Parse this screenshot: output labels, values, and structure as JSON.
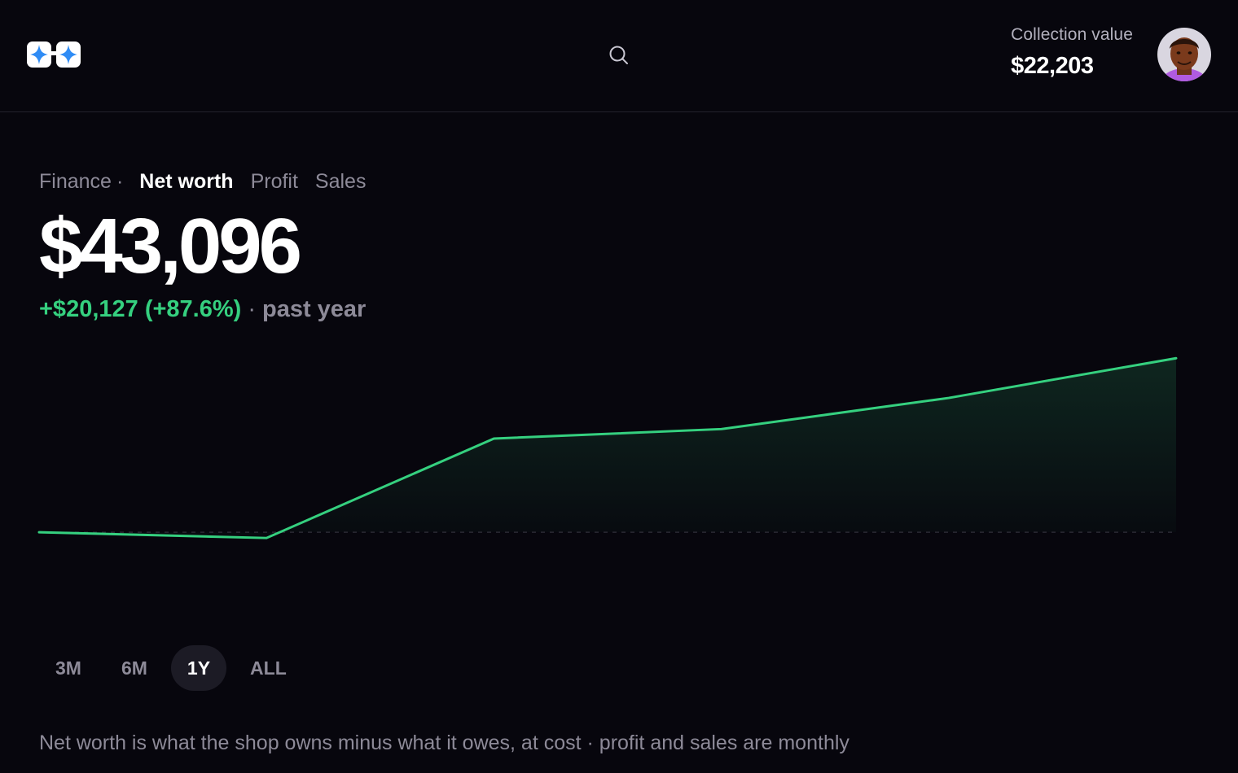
{
  "header": {
    "logo_icon": "sparkle-glasses-logo",
    "search_icon": "search-icon",
    "collection_label": "Collection value",
    "collection_value": "$22,203",
    "avatar_icon": "user-avatar"
  },
  "nav": {
    "section": "Finance",
    "separator": "·",
    "tabs": [
      {
        "label": "Net worth",
        "active": true
      },
      {
        "label": "Profit",
        "active": false
      },
      {
        "label": "Sales",
        "active": false
      }
    ]
  },
  "summary": {
    "value": "$43,096",
    "change": "+$20,127 (+87.6%)",
    "separator": "·",
    "period": "past year"
  },
  "colors": {
    "accent_green": "#35d07f",
    "background": "#07060d",
    "muted_text": "#8d8a98"
  },
  "chart_data": {
    "type": "area",
    "series": [
      {
        "values": [
          22969,
          22300,
          33800,
          34900,
          38500,
          43096
        ]
      }
    ],
    "baseline": 22969,
    "ylim": [
      13000,
      45000
    ],
    "grid": false
  },
  "ranges": [
    {
      "label": "3M",
      "active": false
    },
    {
      "label": "6M",
      "active": false
    },
    {
      "label": "1Y",
      "active": true
    },
    {
      "label": "ALL",
      "active": false
    }
  ],
  "footnote": "Net worth is what the shop owns minus what it owes, at cost · profit and sales are monthly"
}
